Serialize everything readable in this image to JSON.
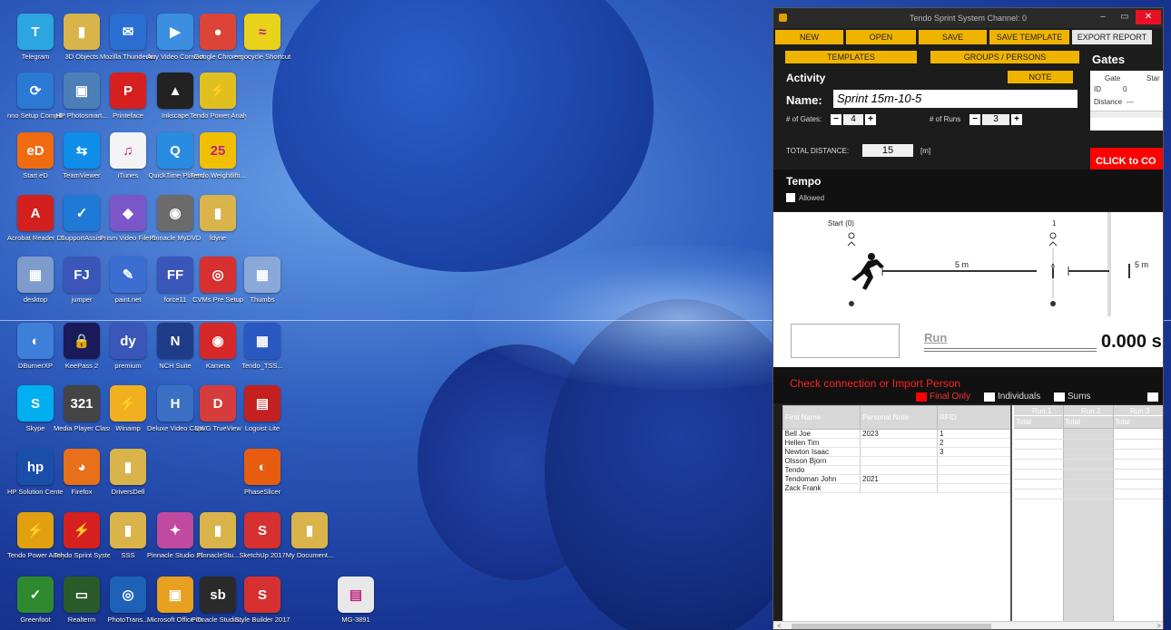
{
  "desktop": {
    "icons": [
      {
        "label": "Telegram",
        "glyph": "T",
        "color": "#2ca5e0"
      },
      {
        "label": "3D Objects",
        "glyph": "▮",
        "color": "#d9b44a"
      },
      {
        "label": "Mozilla Thunderbird",
        "glyph": "✉",
        "color": "#2b6ed1"
      },
      {
        "label": "Any Video Converter",
        "glyph": "▶",
        "color": "#3b8ee0"
      },
      {
        "label": "Google Chrome",
        "glyph": "●",
        "color": "#db4437"
      },
      {
        "label": "ergocycle Shortcut",
        "glyph": "≈",
        "color": "#e8d21a"
      },
      {
        "label": "nno Setup Compiler",
        "glyph": "⟳",
        "color": "#2a7ad4"
      },
      {
        "label": "HP Photosmart...",
        "glyph": "▣",
        "color": "#4c7fb8"
      },
      {
        "label": "Printeface",
        "glyph": "P",
        "color": "#d62020"
      },
      {
        "label": "Inkscape",
        "glyph": "▲",
        "color": "#222222"
      },
      {
        "label": "Tendo Power Analyzer",
        "glyph": "⚡",
        "color": "#e0c020"
      },
      {
        "label": "Start eD",
        "glyph": "eD",
        "color": "#f06a10"
      },
      {
        "label": "TeamViewer",
        "glyph": "⇆",
        "color": "#0e8ee9"
      },
      {
        "label": "iTunes",
        "glyph": "♫",
        "color": "#f3f3f3"
      },
      {
        "label": "QuickTime Player",
        "glyph": "Q",
        "color": "#2a8ce0"
      },
      {
        "label": "Tendo Weightlifti...",
        "glyph": "25",
        "color": "#f0c000"
      },
      {
        "label": "Acrobat Reader DC",
        "glyph": "A",
        "color": "#d41f1f"
      },
      {
        "label": "SupportAssist",
        "glyph": "✓",
        "color": "#1e7ad6"
      },
      {
        "label": "Prism Video File Conv...",
        "glyph": "◆",
        "color": "#7a56c8"
      },
      {
        "label": "Pinnacle MyDVD",
        "glyph": "◉",
        "color": "#6b6b6b"
      },
      {
        "label": "fdyne",
        "glyph": "▮",
        "color": "#d9b44a"
      },
      {
        "label": "desktop",
        "glyph": "▦",
        "color": "#7d9ccc"
      },
      {
        "label": "jumper",
        "glyph": "FJ",
        "color": "#3956b8"
      },
      {
        "label": "paint.net",
        "glyph": "✎",
        "color": "#3b6ed0"
      },
      {
        "label": "force11",
        "glyph": "FF",
        "color": "#3956b8"
      },
      {
        "label": "CVMs Pre Setup",
        "glyph": "◎",
        "color": "#d63030"
      },
      {
        "label": "Thumbs",
        "glyph": "▦",
        "color": "#8aa8d8"
      },
      {
        "label": "DBurnerXP",
        "glyph": "◐",
        "color": "#3d7fd9"
      },
      {
        "label": "KeePass 2",
        "glyph": "🔒",
        "color": "#1a1a5a"
      },
      {
        "label": "premium",
        "glyph": "dy",
        "color": "#3956b8"
      },
      {
        "label": "NCH Suite",
        "glyph": "N",
        "color": "#1f3c88"
      },
      {
        "label": "Kamera",
        "glyph": "◉",
        "color": "#d62828"
      },
      {
        "label": "Tendo_TSS...",
        "glyph": "▦",
        "color": "#2b58c0"
      },
      {
        "label": "Skype",
        "glyph": "S",
        "color": "#00aff0"
      },
      {
        "label": "Media Player Classic",
        "glyph": "321",
        "color": "#444444"
      },
      {
        "label": "Winamp",
        "glyph": "⚡",
        "color": "#f0b020"
      },
      {
        "label": "Deluxe Video Capture-Ed...",
        "glyph": "H",
        "color": "#3a6fc4"
      },
      {
        "label": "DWG TrueView",
        "glyph": "D",
        "color": "#d63c3c"
      },
      {
        "label": "Logoist Lite",
        "glyph": "▤",
        "color": "#c42020"
      },
      {
        "label": "HP Solution Center",
        "glyph": "hp",
        "color": "#1a4ea8"
      },
      {
        "label": "Firefox",
        "glyph": "◕",
        "color": "#e8701a"
      },
      {
        "label": "DriversDell",
        "glyph": "▮",
        "color": "#d9b44a"
      },
      {
        "label": "PhaseSlicer",
        "glyph": "◐",
        "color": "#e85c10"
      },
      {
        "label": "Tendo Power Analyzer",
        "glyph": "⚡",
        "color": "#e0a010"
      },
      {
        "label": "Tendo Sprint System",
        "glyph": "⚡",
        "color": "#d62020"
      },
      {
        "label": "SSS",
        "glyph": "▮",
        "color": "#d9b44a"
      },
      {
        "label": "Pinnacle Studio 21",
        "glyph": "✦",
        "color": "#c04aa0"
      },
      {
        "label": "PinnacleStu...",
        "glyph": "▮",
        "color": "#d9b44a"
      },
      {
        "label": "SketchUp 2017",
        "glyph": "S",
        "color": "#d63030"
      },
      {
        "label": "My Document...",
        "glyph": "▮",
        "color": "#d9b44a"
      },
      {
        "label": "Greenfoot",
        "glyph": "✓",
        "color": "#2f8a2f"
      },
      {
        "label": "Realterm",
        "glyph": "▭",
        "color": "#2a5a2a"
      },
      {
        "label": "PhotoTrans...",
        "glyph": "◎",
        "color": "#1e62b8"
      },
      {
        "label": "Microsoft Office Outl...",
        "glyph": "▣",
        "color": "#e8a020"
      },
      {
        "label": "Pinnacle Studio...",
        "glyph": "sb",
        "color": "#2a2a2a"
      },
      {
        "label": "Style Builder 2017",
        "glyph": "S",
        "color": "#d63030"
      },
      {
        "label": "MG-3891",
        "glyph": "▤",
        "color": "#e8e8e8"
      }
    ]
  },
  "app": {
    "title": "Tendo Sprint System Channel: 0",
    "controls": [
      "–",
      "▭",
      "✕"
    ],
    "menu": [
      "NEW",
      "OPEN",
      "SAVE",
      "SAVE TEMPLATE",
      "EXPORT REPORT"
    ],
    "tabs": [
      "TEMPLATES",
      "GROUPS / PERSONS"
    ],
    "activity": {
      "heading": "Activity",
      "note_button": "NOTE",
      "name_label": "Name:",
      "name_value": "Sprint 15m-10-5",
      "gates_label": "# of Gates:",
      "gates_value": "4",
      "runs_label": "# of Runs",
      "runs_value": "3",
      "total_distance_label": "TOTAL DISTANCE:",
      "total_distance_value": "15",
      "total_distance_unit": "[m]"
    },
    "gates": {
      "heading": "Gates",
      "col_gate": "Gate",
      "col_start": "Star",
      "id_label": "ID",
      "id_value": "0",
      "distance_label": "Distance",
      "distance_value": "---",
      "connect_button": "CLICK to CO"
    },
    "tempo": {
      "heading": "Tempo",
      "allowed_label": "Allowed",
      "allowed_checked": false
    },
    "diagram": {
      "start_label": "Start (0)",
      "gate1_label": "1",
      "seg1_label": "5 m",
      "seg2_label": "5 m"
    },
    "run": {
      "label": "Run",
      "time": "0.000 s"
    },
    "import_message": "Check connection or Import Person",
    "filters": [
      {
        "label": "Final Only",
        "checked": true
      },
      {
        "label": "Individuals",
        "checked": false
      },
      {
        "label": "Sums",
        "checked": false
      }
    ],
    "people_table": {
      "headers": [
        "First Name",
        "Personal Note",
        "RFID"
      ],
      "rows": [
        [
          "Bell Joe",
          "2023",
          "1"
        ],
        [
          "Hellen Tim",
          "",
          "2"
        ],
        [
          "Newton Isaac",
          "",
          "3"
        ],
        [
          "Olsson Bjorn",
          "",
          ""
        ],
        [
          "Tendo",
          "",
          ""
        ],
        [
          "Tendoman John",
          "2021",
          ""
        ],
        [
          "Zack Frank",
          "",
          ""
        ]
      ]
    },
    "runs_table": {
      "headers": [
        "Run 1",
        "Run 2",
        "Run 3"
      ],
      "subheader": "Total",
      "row_count": 7
    },
    "scroll_left": "<",
    "scroll_right": ">"
  }
}
